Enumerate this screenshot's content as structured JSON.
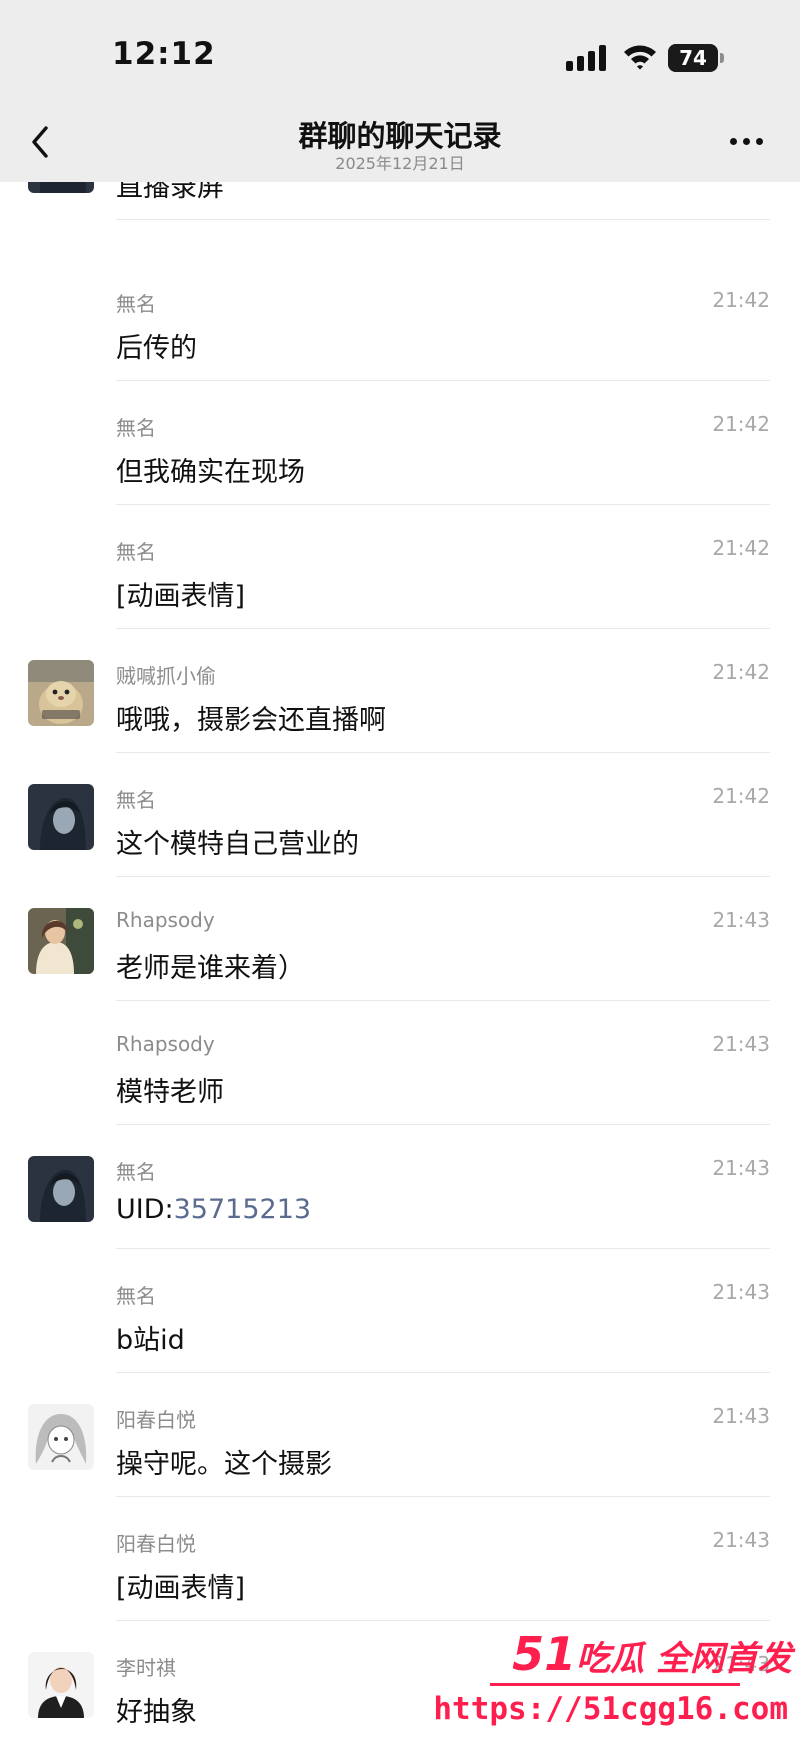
{
  "status_bar": {
    "time": "12:12",
    "battery": "74",
    "battery_fraction": 0.74
  },
  "nav": {
    "title": "群聊的聊天记录",
    "subtitle": "2025年12月21日",
    "back_icon": "chevron-left-icon",
    "more_icon": "more-horizontal-icon"
  },
  "messages": [
    {
      "sender": "",
      "time": "",
      "text": "直播录屏",
      "avatar": "dark-anime-avatar"
    },
    {
      "sender": "無名",
      "time": "21:42",
      "text": "后传的",
      "avatar": ""
    },
    {
      "sender": "無名",
      "time": "21:42",
      "text": "但我确实在现场",
      "avatar": ""
    },
    {
      "sender": "無名",
      "time": "21:42",
      "text": "[动画表情]",
      "avatar": ""
    },
    {
      "sender": "贼喊抓小偷",
      "time": "21:42",
      "text": "哦哦，摄影会还直播啊",
      "avatar": "hamster-avatar"
    },
    {
      "sender": "無名",
      "time": "21:42",
      "text": "这个模特自己营业的",
      "avatar": "dark-anime-avatar"
    },
    {
      "sender": "Rhapsody",
      "time": "21:43",
      "text": "老师是谁来着）",
      "avatar": "photo-girl-avatar"
    },
    {
      "sender": "Rhapsody",
      "time": "21:43",
      "text": "模特老师",
      "avatar": ""
    },
    {
      "sender": "無名",
      "time": "21:43",
      "text_prefix": "UID:",
      "text_link": "35715213",
      "avatar": "dark-anime-avatar"
    },
    {
      "sender": "無名",
      "time": "21:43",
      "text": "b站id",
      "avatar": ""
    },
    {
      "sender": "阳春白悦",
      "time": "21:43",
      "text": "操守呢。这个摄影",
      "avatar": "sketch-anime-avatar"
    },
    {
      "sender": "阳春白悦",
      "time": "21:43",
      "text": "[动画表情]",
      "avatar": ""
    },
    {
      "sender": "李时祺",
      "time": "21:43",
      "text": "好抽象",
      "avatar": "portrait-woman-avatar"
    }
  ],
  "watermark": {
    "brand_number": "51",
    "brand_text": "吃瓜 全网首发",
    "url": "https://51cgg16.com"
  },
  "colors": {
    "header_bg": "#ededed",
    "link": "#5b6b8f",
    "watermark": "#ff1f4f"
  }
}
